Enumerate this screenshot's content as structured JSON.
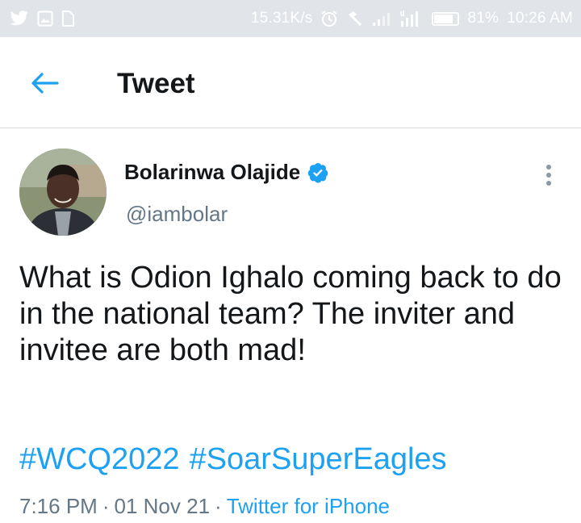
{
  "status_bar": {
    "network_speed": "15.31K/s",
    "battery_percent": "81%",
    "battery_level": 0.81,
    "time": "10:26 AM",
    "left_icons": [
      "twitter-icon",
      "gallery-icon",
      "file-icon"
    ],
    "right_icons": [
      "alarm-icon",
      "hammer-icon",
      "signal-icon",
      "signal-4g-icon"
    ]
  },
  "header": {
    "back_icon": "arrow-left-icon",
    "title": "Tweet"
  },
  "tweet": {
    "author": {
      "name": "Bolarinwa Olajide",
      "handle": "@iambolar",
      "verified": true
    },
    "text": "What is Odion Ighalo coming back to do in the national team? The inviter and invitee are both mad!",
    "hashtags": [
      "#WCQ2022",
      "#SoarSuperEagles"
    ],
    "time": "7:16 PM",
    "separator": "·",
    "date": "01 Nov 21",
    "source": "Twitter for iPhone"
  },
  "colors": {
    "accent": "#1da1f2",
    "muted": "#657786",
    "text": "#14171a",
    "status_bar": "#e1e4e8"
  }
}
